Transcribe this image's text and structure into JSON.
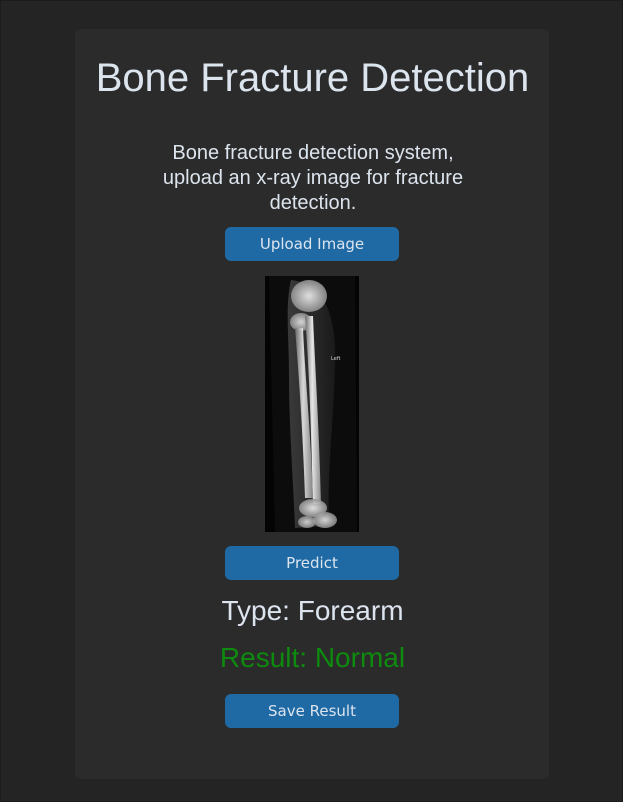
{
  "app": {
    "title": "Bone Fracture Detection",
    "description": "Bone fracture detection system, upload an x-ray image for fracture detection."
  },
  "buttons": {
    "upload_label": "Upload Image",
    "predict_label": "Predict",
    "save_label": "Save Result"
  },
  "image": {
    "marker_text": "Left"
  },
  "results": {
    "type_text": "Type: Forearm",
    "result_text": "Result: Normal"
  },
  "colors": {
    "accent": "#1f6aa5",
    "result_normal": "#0e8a0e",
    "text": "#dce4ee",
    "card_background": "#2b2b2b",
    "window_background": "#242424"
  }
}
